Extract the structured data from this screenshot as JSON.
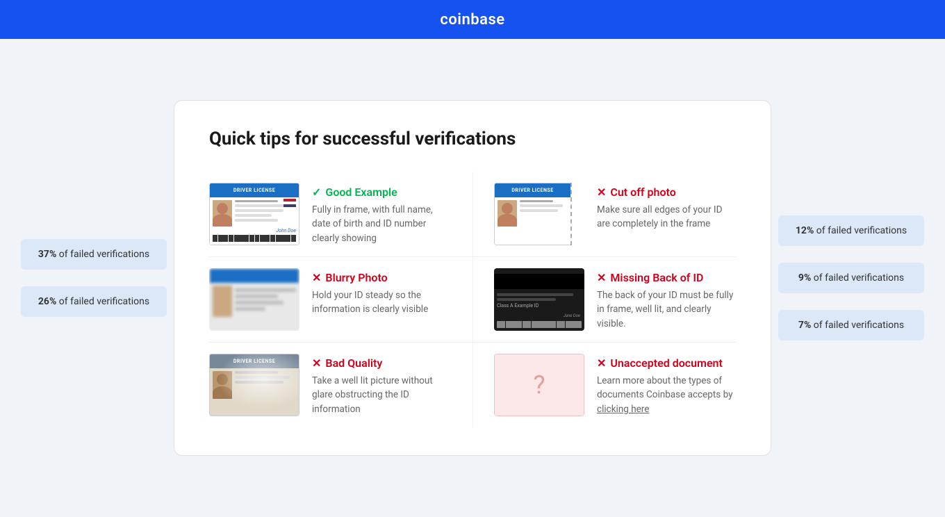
{
  "header": {
    "logo": "coinbase"
  },
  "page": {
    "title": "Quick tips for successful verifications"
  },
  "left_badges": [
    {
      "percent": "37%",
      "label": "of failed verifications"
    },
    {
      "percent": "26%",
      "label": "of failed verifications"
    }
  ],
  "right_badges": [
    {
      "percent": "12%",
      "label": "of failed verifications"
    },
    {
      "percent": "9%",
      "label": "of failed verifications"
    },
    {
      "percent": "7%",
      "label": "of failed verifications"
    }
  ],
  "tips": {
    "left": [
      {
        "type": "good",
        "label": "Good Example",
        "desc": "Fully in frame, with full name, date of birth and ID number clearly showing"
      },
      {
        "type": "bad",
        "label": "Blurry Photo",
        "desc": "Hold your ID steady so the information is clearly visible"
      },
      {
        "type": "bad",
        "label": "Bad Quality",
        "desc": "Take a well lit picture without glare obstructing the ID information"
      }
    ],
    "right": [
      {
        "type": "bad",
        "label": "Cut off photo",
        "desc": "Make sure all edges of your ID are completely in the frame"
      },
      {
        "type": "bad",
        "label": "Missing Back of ID",
        "desc": "The back of your ID must be fully in frame, well lit, and clearly visible."
      },
      {
        "type": "bad",
        "label": "Unaccepted document",
        "desc": "Learn more about the types of documents Coinbase accepts by",
        "link_text": "clicking here",
        "link_href": "#"
      }
    ]
  }
}
